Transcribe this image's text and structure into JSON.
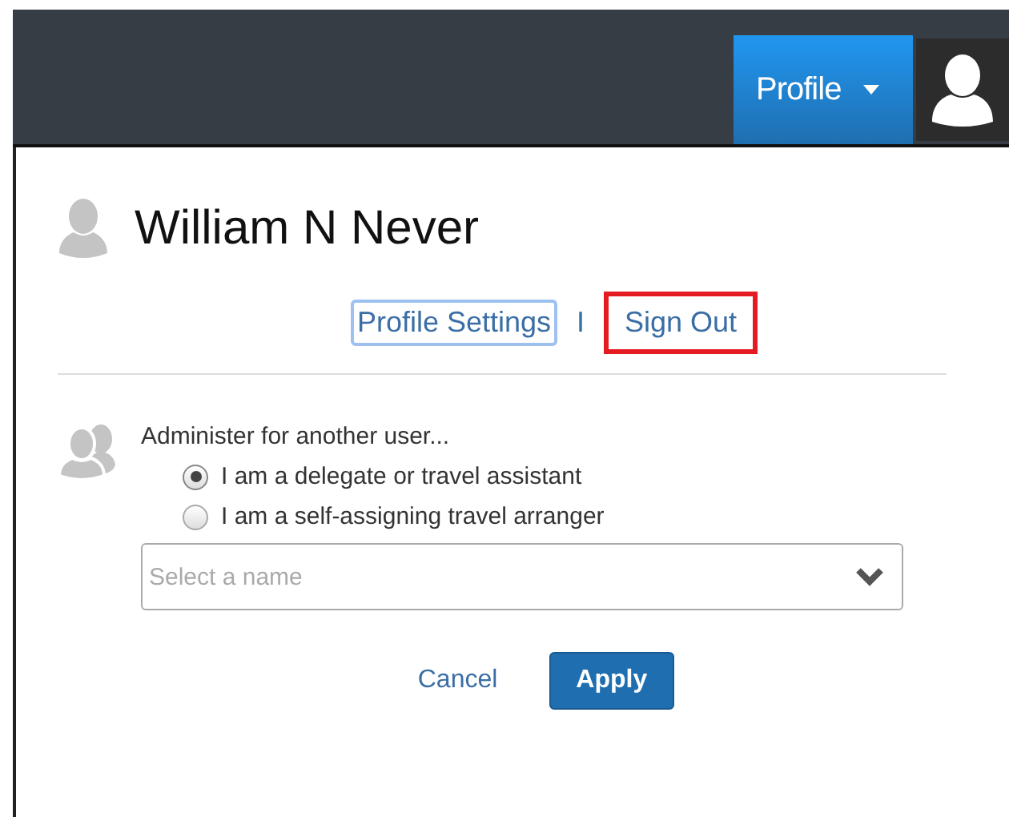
{
  "header": {
    "profile_button": "Profile"
  },
  "user": {
    "name": "William N Never"
  },
  "links": [
    {
      "label": "Profile Settings",
      "focused": true,
      "highlighted": false
    },
    {
      "label": "Sign Out",
      "focused": false,
      "highlighted": true
    }
  ],
  "separator": "I",
  "administer": {
    "title": "Administer for another user...",
    "options": [
      {
        "label": "I am a delegate or travel assistant",
        "selected": true
      },
      {
        "label": "I am a self-assigning travel arranger",
        "selected": false
      }
    ],
    "select": {
      "placeholder": "Select a name"
    }
  },
  "buttons": [
    {
      "label": "Cancel",
      "kind": "link"
    },
    {
      "label": "Apply",
      "kind": "primary"
    }
  ]
}
